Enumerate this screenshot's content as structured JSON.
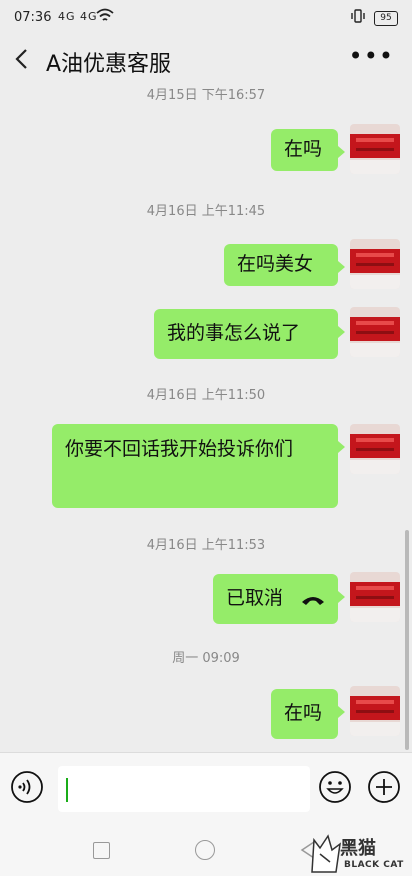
{
  "status": {
    "time": "07:36",
    "signal": "4G 4G",
    "battery": "95"
  },
  "header": {
    "title": "A油优惠客服"
  },
  "messages": [
    {
      "type": "timestamp",
      "text": "4月15日 下午16:57"
    },
    {
      "type": "sent",
      "text": "在吗"
    },
    {
      "type": "timestamp",
      "text": "4月16日 上午11:45"
    },
    {
      "type": "sent",
      "text": "在吗美女"
    },
    {
      "type": "sent",
      "text": "我的事怎么说了"
    },
    {
      "type": "timestamp",
      "text": "4月16日 上午11:50"
    },
    {
      "type": "sent",
      "text": "你要不回话我开始投诉你们"
    },
    {
      "type": "timestamp",
      "text": "4月16日 上午11:53"
    },
    {
      "type": "sent_call",
      "text": "已取消",
      "icon": "call-cancelled-icon"
    },
    {
      "type": "timestamp",
      "text": "周一 09:09"
    },
    {
      "type": "sent",
      "text": "在吗"
    }
  ],
  "input": {
    "value": "",
    "placeholder": ""
  },
  "colors": {
    "background": "#ededed",
    "sent_bubble": "#95ec69",
    "cursor": "#1aad19"
  },
  "watermark": {
    "text": "黑猫",
    "sub": "BLACK CAT"
  }
}
